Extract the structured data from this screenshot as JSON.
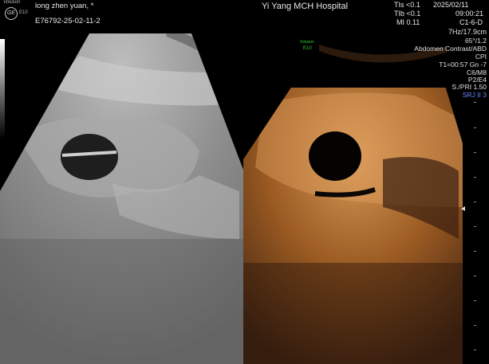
{
  "header": {
    "brand": "Voluson",
    "model": "E10",
    "patient_name": "long  zhen  yuan,  *",
    "patient_id": "E76792-25-02-11-2",
    "hospital": "Yi Yang MCH Hospital",
    "tis": "TIs <0.1",
    "tib": "TIb <0.1",
    "mi": "MI 0.11",
    "date": "2025/02/11",
    "time": "09:00:21",
    "probe": "C1-6-D"
  },
  "params": {
    "freq_depth": "7Hz/17.9cm",
    "angle": "65°/1.2",
    "preset": "Abdomen Contrast/ABD",
    "mode": "CPI",
    "timer_gain": "T1=00:57  Gn -7",
    "c_m": "C6/M8",
    "p_e": "P2/E4",
    "s_pri": "S./PRI 1.50",
    "srj": "SRJ II 3"
  },
  "contrast_label": {
    "brand": "Voluson",
    "model": "E10"
  },
  "colors": {
    "background": "#000000",
    "bmode": "#9a9a9a",
    "contrast": "#b06a28",
    "green_label": "#2fd02f",
    "blue_label": "#6a86ff"
  }
}
